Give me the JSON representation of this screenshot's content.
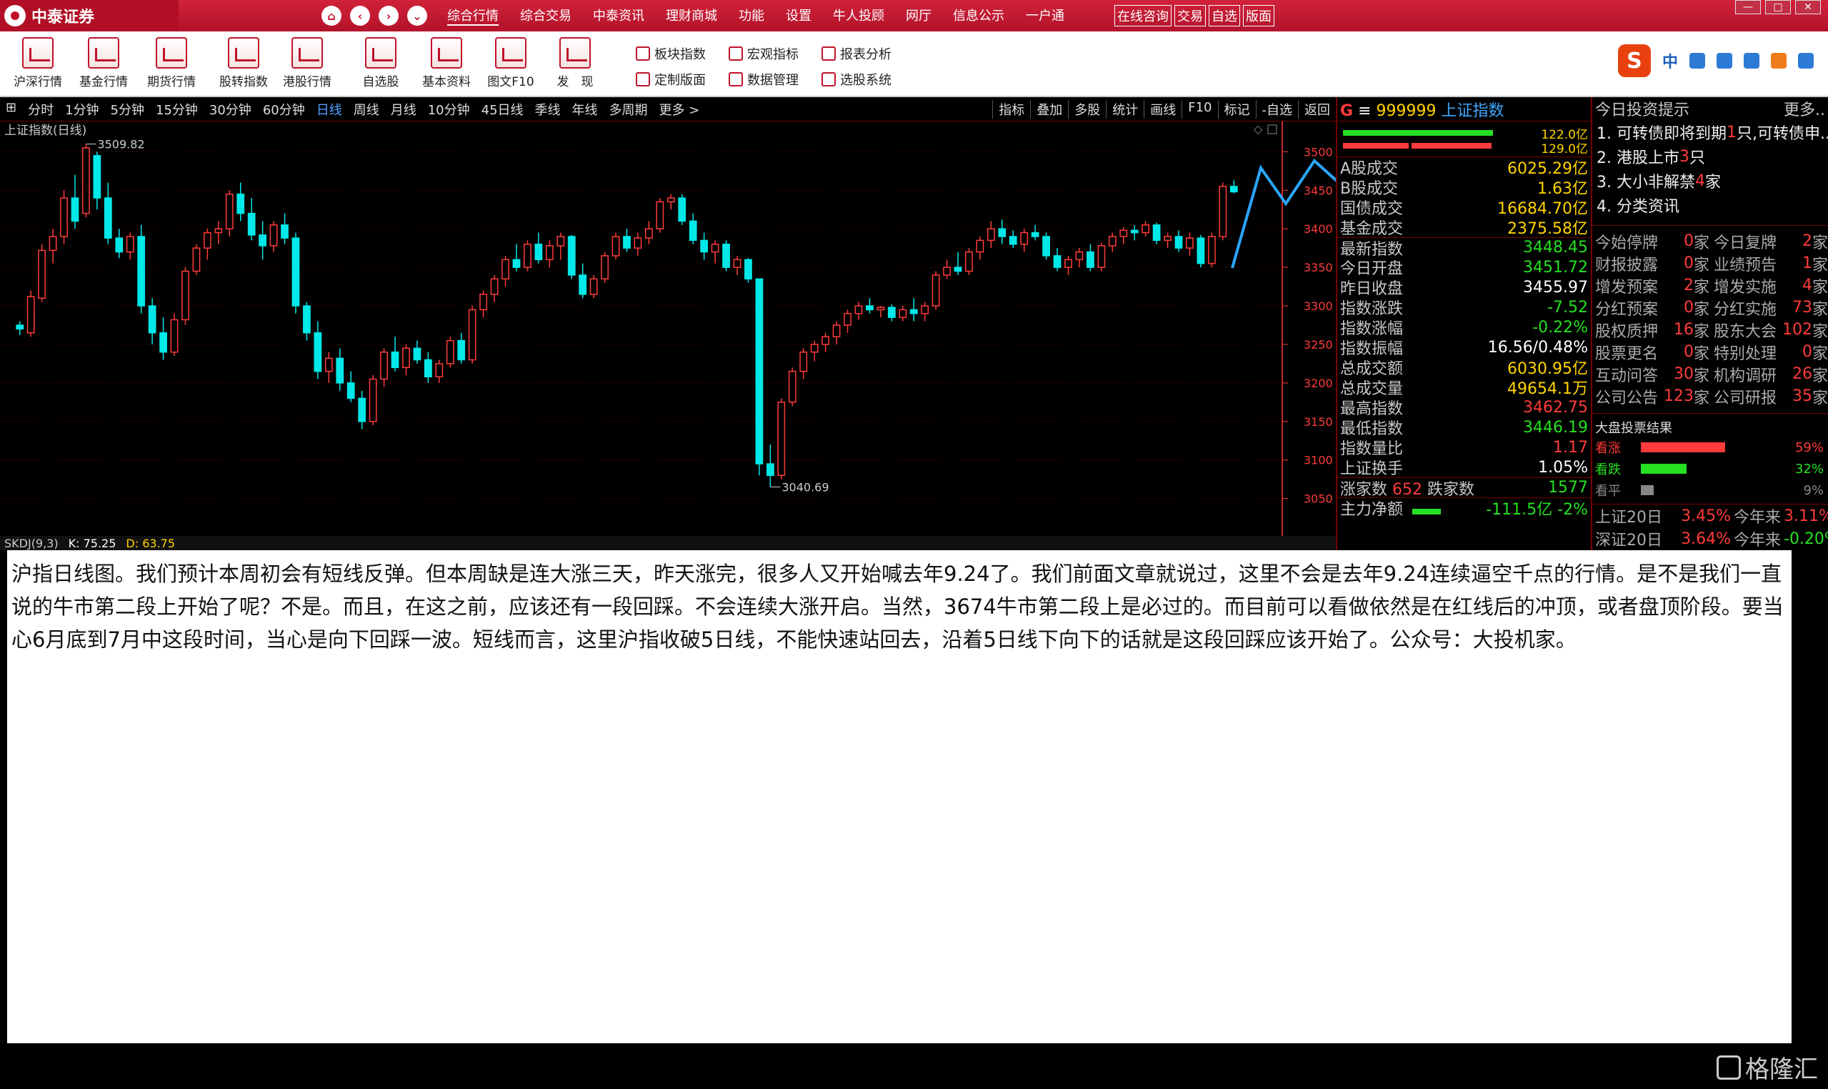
{
  "app": {
    "brand": "中泰证券"
  },
  "menus": [
    "综合行情",
    "综合交易",
    "中泰资讯",
    "理财商城",
    "功能",
    "设置",
    "牛人投顾",
    "网厅",
    "信息公示",
    "一户通"
  ],
  "redbtns": [
    "在线咨询",
    "交易",
    "自选",
    "版面"
  ],
  "toolbar": {
    "big": [
      "沪深行情",
      "基金行情",
      "期货行情",
      "股转指数",
      "港股行情",
      "自选股",
      "基本资料",
      "图文F10",
      "发　现"
    ],
    "small": [
      "板块指数",
      "宏观指标",
      "报表分析",
      "定制版面",
      "数据管理",
      "选股系统"
    ]
  },
  "periods": [
    "分时",
    "1分钟",
    "5分钟",
    "15分钟",
    "30分钟",
    "60分钟",
    "日线",
    "周线",
    "月线",
    "10分钟",
    "45日线",
    "季线",
    "年线",
    "多周期",
    "更多 >"
  ],
  "active_period": "日线",
  "chart_tools": [
    "指标",
    "叠加",
    "多股",
    "统计",
    "画线",
    "F10",
    "标记",
    "-自选",
    "返回"
  ],
  "chart_title": "上证指数(日线)",
  "chart_data": {
    "type": "candlestick",
    "ylim": [
      3020,
      3530
    ],
    "yticks": [
      3500,
      3450,
      3400,
      3350,
      3300,
      3250,
      3200,
      3150,
      3100,
      3050
    ],
    "high_label": "3509.82",
    "low_label": "3040.69",
    "candles": [
      [
        3275,
        3280,
        3262,
        3270
      ],
      [
        3265,
        3320,
        3260,
        3312
      ],
      [
        3310,
        3380,
        3305,
        3372
      ],
      [
        3372,
        3400,
        3355,
        3390
      ],
      [
        3390,
        3450,
        3380,
        3440
      ],
      [
        3440,
        3470,
        3400,
        3410
      ],
      [
        3420,
        3510,
        3415,
        3505
      ],
      [
        3495,
        3500,
        3425,
        3440
      ],
      [
        3440,
        3460,
        3380,
        3388
      ],
      [
        3388,
        3400,
        3362,
        3370
      ],
      [
        3370,
        3395,
        3360,
        3390
      ],
      [
        3390,
        3405,
        3290,
        3300
      ],
      [
        3300,
        3310,
        3250,
        3265
      ],
      [
        3265,
        3285,
        3230,
        3240
      ],
      [
        3240,
        3290,
        3235,
        3282
      ],
      [
        3282,
        3350,
        3275,
        3345
      ],
      [
        3345,
        3380,
        3340,
        3375
      ],
      [
        3375,
        3400,
        3360,
        3395
      ],
      [
        3395,
        3410,
        3380,
        3400
      ],
      [
        3400,
        3450,
        3390,
        3445
      ],
      [
        3445,
        3460,
        3410,
        3420
      ],
      [
        3420,
        3440,
        3385,
        3392
      ],
      [
        3392,
        3410,
        3360,
        3378
      ],
      [
        3378,
        3410,
        3370,
        3405
      ],
      [
        3405,
        3420,
        3380,
        3388
      ],
      [
        3388,
        3395,
        3290,
        3300
      ],
      [
        3300,
        3305,
        3255,
        3265
      ],
      [
        3265,
        3280,
        3205,
        3215
      ],
      [
        3215,
        3240,
        3200,
        3232
      ],
      [
        3232,
        3245,
        3190,
        3200
      ],
      [
        3200,
        3215,
        3175,
        3180
      ],
      [
        3180,
        3190,
        3140,
        3150
      ],
      [
        3150,
        3210,
        3145,
        3205
      ],
      [
        3205,
        3245,
        3195,
        3240
      ],
      [
        3240,
        3260,
        3215,
        3220
      ],
      [
        3220,
        3250,
        3210,
        3245
      ],
      [
        3245,
        3255,
        3225,
        3230
      ],
      [
        3230,
        3240,
        3200,
        3208
      ],
      [
        3208,
        3230,
        3200,
        3225
      ],
      [
        3225,
        3260,
        3220,
        3255
      ],
      [
        3255,
        3265,
        3225,
        3230
      ],
      [
        3230,
        3300,
        3225,
        3295
      ],
      [
        3295,
        3320,
        3285,
        3315
      ],
      [
        3315,
        3340,
        3305,
        3335
      ],
      [
        3335,
        3365,
        3325,
        3360
      ],
      [
        3360,
        3380,
        3345,
        3350
      ],
      [
        3350,
        3385,
        3345,
        3380
      ],
      [
        3380,
        3395,
        3355,
        3360
      ],
      [
        3360,
        3385,
        3350,
        3378
      ],
      [
        3378,
        3395,
        3360,
        3390
      ],
      [
        3390,
        3392,
        3335,
        3340
      ],
      [
        3340,
        3355,
        3310,
        3315
      ],
      [
        3315,
        3340,
        3310,
        3335
      ],
      [
        3335,
        3370,
        3330,
        3365
      ],
      [
        3365,
        3395,
        3360,
        3390
      ],
      [
        3390,
        3400,
        3370,
        3375
      ],
      [
        3375,
        3395,
        3365,
        3388
      ],
      [
        3388,
        3410,
        3380,
        3400
      ],
      [
        3400,
        3440,
        3395,
        3435
      ],
      [
        3435,
        3445,
        3425,
        3440
      ],
      [
        3440,
        3445,
        3405,
        3410
      ],
      [
        3410,
        3420,
        3380,
        3385
      ],
      [
        3385,
        3395,
        3360,
        3370
      ],
      [
        3370,
        3385,
        3355,
        3380
      ],
      [
        3380,
        3385,
        3345,
        3350
      ],
      [
        3350,
        3365,
        3340,
        3360
      ],
      [
        3360,
        3362,
        3330,
        3335
      ],
      [
        3335,
        3225,
        3080,
        3095
      ],
      [
        3095,
        3120,
        3065,
        3080
      ],
      [
        3080,
        3180,
        3075,
        3175
      ],
      [
        3175,
        3220,
        3170,
        3215
      ],
      [
        3215,
        3245,
        3205,
        3240
      ],
      [
        3240,
        3255,
        3228,
        3250
      ],
      [
        3250,
        3265,
        3240,
        3260
      ],
      [
        3260,
        3280,
        3250,
        3275
      ],
      [
        3275,
        3295,
        3265,
        3290
      ],
      [
        3290,
        3305,
        3282,
        3300
      ],
      [
        3300,
        3310,
        3290,
        3295
      ],
      [
        3295,
        3300,
        3285,
        3298
      ],
      [
        3298,
        3302,
        3280,
        3285
      ],
      [
        3285,
        3300,
        3280,
        3295
      ],
      [
        3295,
        3310,
        3280,
        3290
      ],
      [
        3290,
        3305,
        3280,
        3300
      ],
      [
        3300,
        3345,
        3295,
        3340
      ],
      [
        3340,
        3360,
        3335,
        3350
      ],
      [
        3350,
        3370,
        3340,
        3345
      ],
      [
        3345,
        3375,
        3340,
        3370
      ],
      [
        3370,
        3390,
        3360,
        3385
      ],
      [
        3385,
        3410,
        3375,
        3400
      ],
      [
        3400,
        3412,
        3380,
        3390
      ],
      [
        3390,
        3398,
        3375,
        3380
      ],
      [
        3380,
        3400,
        3370,
        3395
      ],
      [
        3395,
        3405,
        3385,
        3390
      ],
      [
        3390,
        3395,
        3360,
        3365
      ],
      [
        3365,
        3375,
        3345,
        3350
      ],
      [
        3350,
        3365,
        3340,
        3360
      ],
      [
        3360,
        3375,
        3350,
        3370
      ],
      [
        3370,
        3380,
        3345,
        3350
      ],
      [
        3350,
        3382,
        3345,
        3378
      ],
      [
        3378,
        3395,
        3370,
        3390
      ],
      [
        3390,
        3402,
        3380,
        3398
      ],
      [
        3398,
        3405,
        3385,
        3395
      ],
      [
        3395,
        3410,
        3390,
        3405
      ],
      [
        3405,
        3408,
        3380,
        3385
      ],
      [
        3385,
        3395,
        3375,
        3390
      ],
      [
        3390,
        3398,
        3370,
        3375
      ],
      [
        3375,
        3395,
        3365,
        3388
      ],
      [
        3388,
        3392,
        3350,
        3355
      ],
      [
        3355,
        3395,
        3350,
        3390
      ],
      [
        3390,
        3460,
        3385,
        3455
      ],
      [
        3455,
        3463,
        3446,
        3448
      ]
    ]
  },
  "sub_indicator": {
    "name": "SKDJ(9,3)",
    "k": "K: 75.25",
    "d": "D: 63.75"
  },
  "quote": {
    "code": "999999",
    "name": "上证指数",
    "bars": [
      "122.0亿",
      "129.0亿"
    ],
    "rows": [
      {
        "l": "A股成交",
        "v": "6025.29亿",
        "c": "yellow"
      },
      {
        "l": "B股成交",
        "v": "1.63亿",
        "c": "yellow"
      },
      {
        "l": "国债成交",
        "v": "16684.70亿",
        "c": "yellow"
      },
      {
        "l": "基金成交",
        "v": "2375.58亿",
        "c": "yellow"
      },
      {
        "l": "最新指数",
        "v": "3448.45",
        "c": "green"
      },
      {
        "l": "今日开盘",
        "v": "3451.72",
        "c": "green"
      },
      {
        "l": "昨日收盘",
        "v": "3455.97",
        "c": "white"
      },
      {
        "l": "指数涨跌",
        "v": "-7.52",
        "c": "green"
      },
      {
        "l": "指数涨幅",
        "v": "-0.22%",
        "c": "green"
      },
      {
        "l": "指数振幅",
        "v": "16.56/0.48%",
        "c": "white"
      },
      {
        "l": "总成交额",
        "v": "6030.95亿",
        "c": "yellow"
      },
      {
        "l": "总成交量",
        "v": "49654.1万",
        "c": "yellow"
      },
      {
        "l": "最高指数",
        "v": "3462.75",
        "c": "red"
      },
      {
        "l": "最低指数",
        "v": "3446.19",
        "c": "green"
      },
      {
        "l": "指数量比",
        "v": "1.17",
        "c": "red"
      },
      {
        "l": "上证换手",
        "v": "1.05%",
        "c": "white"
      }
    ],
    "adv_label": "涨家数",
    "adv": "652",
    "dec_label": "跌家数",
    "dec": "1577",
    "flow_label": "主力净额",
    "flow": "-111.5亿",
    "flow_pct": "-2%"
  },
  "tips": {
    "title": "今日投资提示",
    "more": "更多..",
    "items": [
      {
        "pre": "1. 可转债即将到期",
        "num": "1",
        "post": "只,可转债申..."
      },
      {
        "pre": "2. 港股上市",
        "num": "3",
        "post": "只"
      },
      {
        "pre": "3. 大小非解禁",
        "num": "4",
        "post": "家"
      },
      {
        "pre": "4. 分类资讯",
        "num": "",
        "post": ""
      }
    ],
    "events": [
      [
        "今始停牌",
        "0",
        "今日复牌",
        "2"
      ],
      [
        "财报披露",
        "0",
        "业绩预告",
        "1"
      ],
      [
        "增发预案",
        "2",
        "增发实施",
        "4"
      ],
      [
        "分红预案",
        "0",
        "分红实施",
        "73"
      ],
      [
        "股权质押",
        "16",
        "股东大会",
        "102"
      ],
      [
        "股票更名",
        "0",
        "特别处理",
        "0"
      ],
      [
        "互动问答",
        "30",
        "机构调研",
        "26"
      ],
      [
        "公司公告",
        "123",
        "公司研报",
        "35"
      ]
    ],
    "unit": "家",
    "vote_title": "大盘投票结果",
    "votes": [
      {
        "l": "看涨",
        "p": "59%",
        "f": 0.59,
        "c": "#ff3b3b"
      },
      {
        "l": "看跌",
        "p": "32%",
        "f": 0.32,
        "c": "#26e021"
      },
      {
        "l": "看平",
        "p": "9%",
        "f": 0.09,
        "c": "#888"
      }
    ],
    "foot": [
      {
        "l": "上证20日",
        "v": "3.45%",
        "l2": "今年来",
        "v2": "3.11%"
      },
      {
        "l": "深证20日",
        "v": "3.64%",
        "l2": "今年来",
        "v2": "-0.20%"
      }
    ]
  },
  "article": "沪指日线图。我们预计本周初会有短线反弹。但本周缺是连大涨三天，昨天涨完，很多人又开始喊去年9.24了。我们前面文章就说过，这里不会是去年9.24连续逼空千点的行情。是不是我们一直说的牛市第二段上开始了呢？不是。而且，在这之前，应该还有一段回踩。不会连续大涨开启。当然，3674牛市第二段上是必过的。而目前可以看做依然是在红线后的冲顶，或者盘顶阶段。要当心6月底到7月中这段时间，当心是向下回踩一波。短线而言，这里沪指收破5日线，不能快速站回去，沿着5日线下向下的话就是这段回踩应该开始了。公众号：大投机家。",
  "watermark": "格隆汇",
  "colors": {
    "up": "#ff3b3b",
    "down": "#00e8e8",
    "axis": "#ff3b3b",
    "arrow": "#2aa6ff"
  }
}
